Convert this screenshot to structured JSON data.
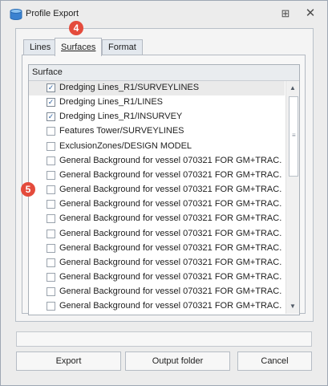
{
  "window": {
    "title": "Profile Export",
    "pin_glyph": "⊞",
    "close_glyph": "✕"
  },
  "tabs": [
    {
      "label": "Lines"
    },
    {
      "label": "Surfaces",
      "active": true
    },
    {
      "label": "Format"
    }
  ],
  "grid": {
    "column_header": "Surface",
    "rows": [
      {
        "label": "Dredging Lines_R1/SURVEYLINES",
        "checked": true,
        "selected": true
      },
      {
        "label": "Dredging Lines_R1/LINES",
        "checked": true
      },
      {
        "label": "Dredging Lines_R1/INSURVEY",
        "checked": true
      },
      {
        "label": "Features Tower/SURVEYLINES",
        "checked": false
      },
      {
        "label": "ExclusionZones/DESIGN MODEL",
        "checked": false
      },
      {
        "label": "General Background for vessel 070321 FOR GM+TRAC...",
        "checked": false
      },
      {
        "label": "General Background for vessel 070321 FOR GM+TRAC...",
        "checked": false
      },
      {
        "label": "General Background for vessel 070321 FOR GM+TRAC...",
        "checked": false
      },
      {
        "label": "General Background for vessel 070321 FOR GM+TRAC...",
        "checked": false
      },
      {
        "label": "General Background for vessel 070321 FOR GM+TRAC...",
        "checked": false
      },
      {
        "label": "General Background for vessel 070321 FOR GM+TRAC...",
        "checked": false
      },
      {
        "label": "General Background for vessel 070321 FOR GM+TRAC...",
        "checked": false
      },
      {
        "label": "General Background for vessel 070321 FOR GM+TRAC...",
        "checked": false
      },
      {
        "label": "General Background for vessel 070321 FOR GM+TRAC...",
        "checked": false
      },
      {
        "label": "General Background for vessel 070321 FOR GM+TRAC...",
        "checked": false
      },
      {
        "label": "General Background for vessel 070321 FOR GM+TRAC...",
        "checked": false
      }
    ],
    "scroll_up_glyph": "▲",
    "scroll_down_glyph": "▼",
    "scroll_grip_glyph": "≡"
  },
  "buttons": {
    "export": "Export",
    "output_folder": "Output folder",
    "cancel": "Cancel"
  },
  "annotations": {
    "badge_tab": "4",
    "badge_list": "5"
  },
  "colors": {
    "badge": "#e44b3c",
    "check_mark": "#2b5f9e"
  },
  "icons": {
    "app": "database-icon"
  }
}
